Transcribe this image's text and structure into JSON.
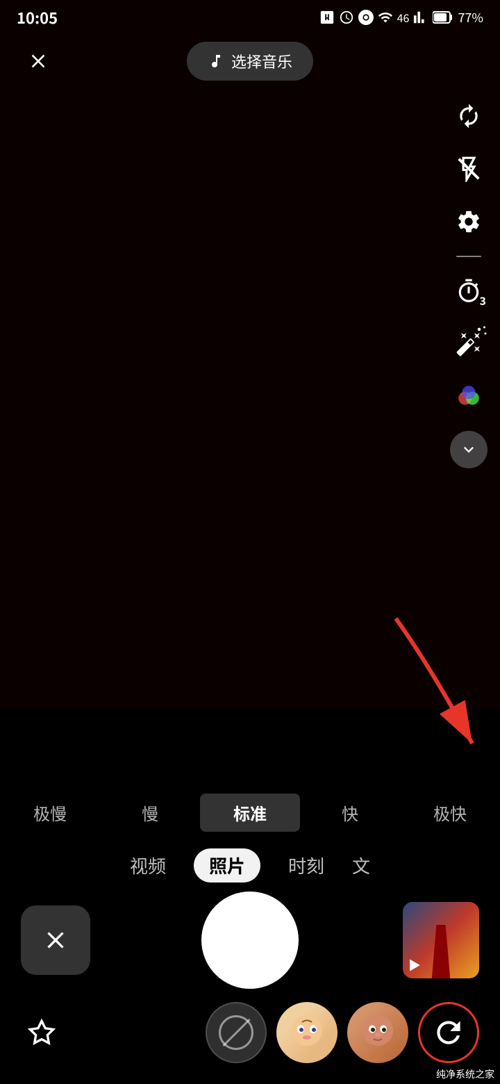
{
  "statusBar": {
    "time": "10:05",
    "battery": "77%"
  },
  "topControls": {
    "closeLabel": "×",
    "musicButtonLabel": "选择音乐"
  },
  "speedSelector": {
    "items": [
      {
        "label": "极慢",
        "active": false
      },
      {
        "label": "慢",
        "active": false
      },
      {
        "label": "标准",
        "active": true
      },
      {
        "label": "快",
        "active": false
      },
      {
        "label": "极快",
        "active": false
      }
    ]
  },
  "modeSelector": {
    "items": [
      {
        "label": "视频",
        "active": false
      },
      {
        "label": "照片",
        "active": true
      },
      {
        "label": "时刻",
        "active": false
      },
      {
        "label": "文",
        "active": false
      }
    ]
  },
  "filterRow": {
    "starLabel": "☆",
    "items": [
      {
        "id": "disabled",
        "label": "禁用"
      },
      {
        "id": "face1",
        "label": "滤镜1"
      },
      {
        "id": "face2",
        "label": "滤镜2"
      },
      {
        "id": "refresh",
        "label": "刷新"
      }
    ]
  },
  "sidebarIcons": {
    "refresh": "refresh",
    "flash": "flash-off",
    "settings": "settings",
    "timer": "timer",
    "timerBadge": "3",
    "magic": "magic-wand",
    "colorFilter": "color-filter",
    "chevronDown": "chevron-down"
  },
  "watermark": "纯净系统之家"
}
